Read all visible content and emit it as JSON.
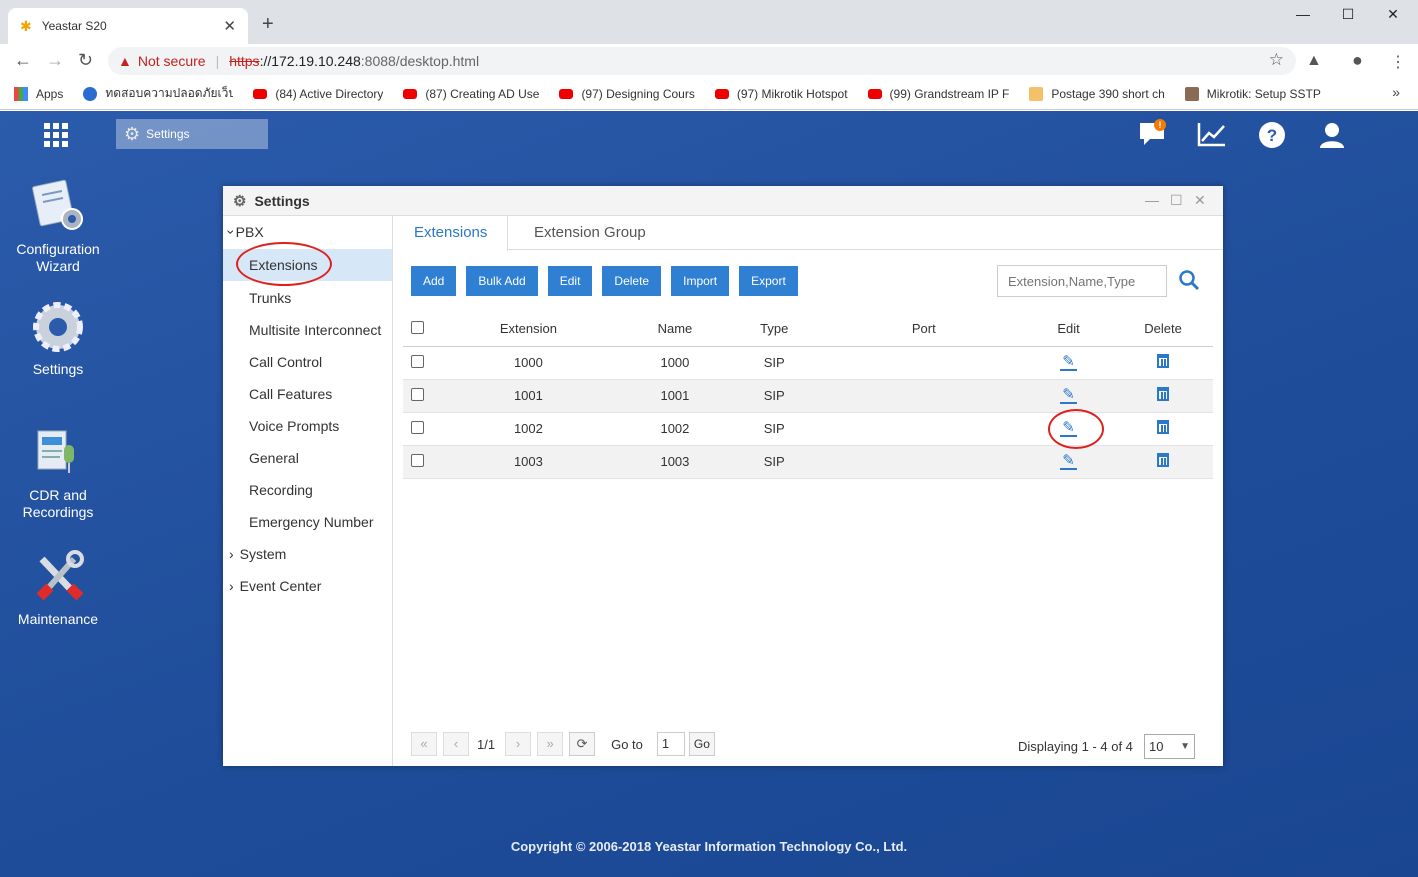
{
  "browser": {
    "tab_title": "Yeastar S20",
    "security_label": "Not secure",
    "url_scheme": "https",
    "url_host": "://172.19.10.248",
    "url_path": ":8088/desktop.html",
    "bookmarks": [
      {
        "label": "Apps",
        "icon": "apps-icon"
      },
      {
        "label": "ทดสอบความปลอดภัยเว็บ",
        "icon": "user-icon"
      },
      {
        "label": "(84) Active Directory",
        "icon": "youtube-icon"
      },
      {
        "label": "(87) Creating AD Use",
        "icon": "youtube-icon"
      },
      {
        "label": "(97) Designing Cours",
        "icon": "youtube-icon"
      },
      {
        "label": "(97) Mikrotik Hotspot",
        "icon": "youtube-icon"
      },
      {
        "label": "(99) Grandstream IP F",
        "icon": "youtube-icon"
      },
      {
        "label": "Postage 390 short ch",
        "icon": "page-icon"
      },
      {
        "label": "Mikrotik: Setup SSTP",
        "icon": "page-icon"
      }
    ]
  },
  "desktop": {
    "taskbar_settings_label": "Settings",
    "icons": [
      {
        "label_line1": "Configuration",
        "label_line2": "Wizard"
      },
      {
        "label_line1": "Settings",
        "label_line2": ""
      },
      {
        "label_line1": "CDR and",
        "label_line2": "Recordings"
      },
      {
        "label_line1": "Maintenance",
        "label_line2": ""
      }
    ],
    "notification_badge": "!",
    "copyright": "Copyright © 2006-2018 Yeastar Information Technology Co., Ltd."
  },
  "window": {
    "title": "Settings",
    "sidebar": {
      "pbx": "PBX",
      "items": [
        "Extensions",
        "Trunks",
        "Multisite Interconnect",
        "Call Control",
        "Call Features",
        "Voice Prompts",
        "General",
        "Recording",
        "Emergency Number"
      ],
      "system": "System",
      "event_center": "Event Center"
    },
    "tabs": [
      "Extensions",
      "Extension Group"
    ],
    "buttons": [
      "Add",
      "Bulk Add",
      "Edit",
      "Delete",
      "Import",
      "Export"
    ],
    "search_placeholder": "Extension,Name,Type",
    "table": {
      "headers": [
        "Extension",
        "Name",
        "Type",
        "Port",
        "Edit",
        "Delete"
      ],
      "rows": [
        {
          "extension": "1000",
          "name": "1000",
          "type": "SIP",
          "port": ""
        },
        {
          "extension": "1001",
          "name": "1001",
          "type": "SIP",
          "port": ""
        },
        {
          "extension": "1002",
          "name": "1002",
          "type": "SIP",
          "port": ""
        },
        {
          "extension": "1003",
          "name": "1003",
          "type": "SIP",
          "port": ""
        }
      ]
    },
    "pager": {
      "page": "1/1",
      "goto_label": "Go to",
      "goto_value": "1",
      "go_button": "Go",
      "display_text": "Displaying 1 - 4 of 4",
      "page_size": "10"
    }
  },
  "colors": {
    "accent": "#2f7fd3",
    "desktop_bg": "#2b5bab",
    "annotation": "#e0201c"
  }
}
